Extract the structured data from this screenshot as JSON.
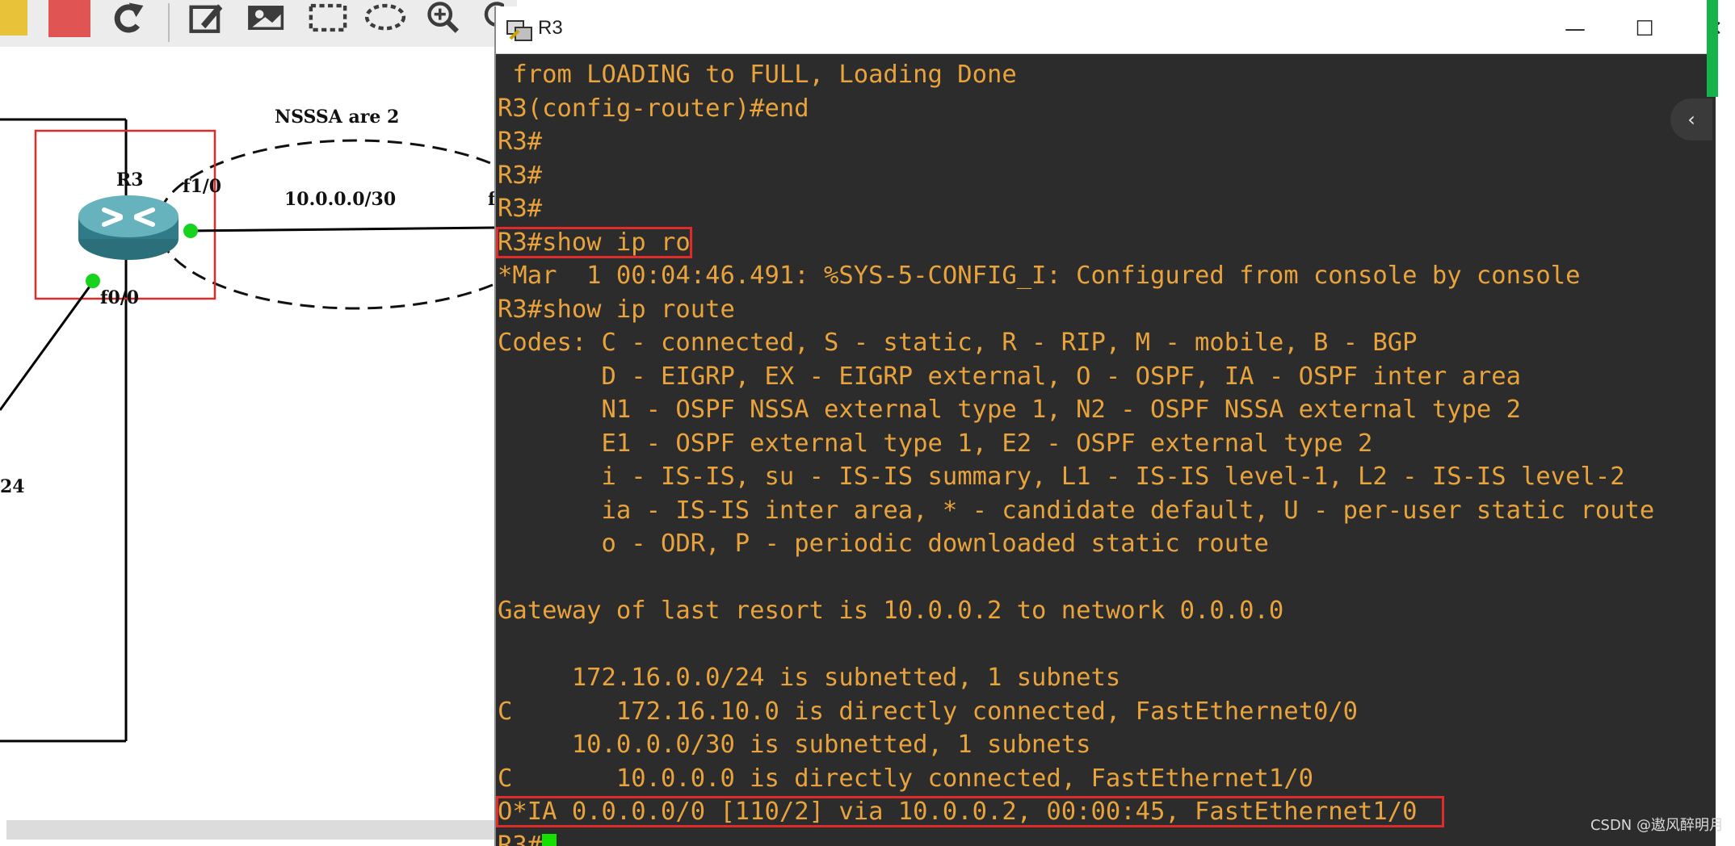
{
  "gns3": {
    "topology": {
      "router_name": "R3",
      "iface_f1_0": "f1/0",
      "iface_f0_0": "f0/0",
      "area_label": "NSSSA  are 2",
      "link_subnet": "10.0.0.0/30",
      "cut_label_f": "f",
      "cut_label_24": "24"
    }
  },
  "terminal": {
    "title": "R3",
    "controls": {
      "minimize": "—",
      "maximize": "☐",
      "close": "✕"
    },
    "lines": [
      " from LOADING to FULL, Loading Done",
      "R3(config-router)#end",
      "R3#",
      "R3#",
      "R3#",
      "R3#show ip ro",
      "*Mar  1 00:04:46.491: %SYS-5-CONFIG_I: Configured from console by console",
      "R3#show ip route",
      "Codes: C - connected, S - static, R - RIP, M - mobile, B - BGP",
      "       D - EIGRP, EX - EIGRP external, O - OSPF, IA - OSPF inter area",
      "       N1 - OSPF NSSA external type 1, N2 - OSPF NSSA external type 2",
      "       E1 - OSPF external type 1, E2 - OSPF external type 2",
      "       i - IS-IS, su - IS-IS summary, L1 - IS-IS level-1, L2 - IS-IS level-2",
      "       ia - IS-IS inter area, * - candidate default, U - per-user static route",
      "       o - ODR, P - periodic downloaded static route",
      "",
      "Gateway of last resort is 10.0.0.2 to network 0.0.0.0",
      "",
      "     172.16.0.0/24 is subnetted, 1 subnets",
      "C       172.16.10.0 is directly connected, FastEthernet0/0",
      "     10.0.0.0/30 is subnetted, 1 subnets",
      "C       10.0.0.0 is directly connected, FastEthernet1/0",
      "O*IA 0.0.0.0/0 [110/2] via 10.0.0.2, 00:00:45, FastEthernet1/0",
      "R3#"
    ]
  },
  "colors": {
    "terminal_bg": "#2c2c2c",
    "terminal_text": "#e8a33d",
    "highlight_border": "#e02b2b",
    "cursor": "#16e000",
    "port_dot": "#17d31f"
  },
  "watermark": "CSDN @遨风醉明月"
}
